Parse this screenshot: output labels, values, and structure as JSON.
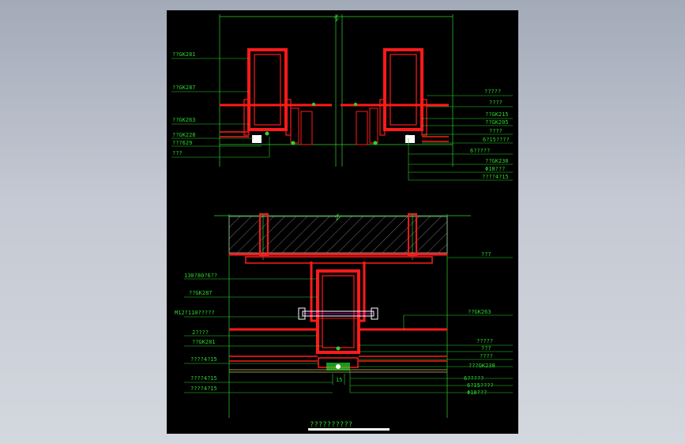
{
  "drawing": {
    "title": "??????????",
    "colors": {
      "background": "#000000",
      "profile": "#ff1a1a",
      "leader": "#2bd62b",
      "frame": "#ffffff",
      "hatch": "#c8c8c8"
    },
    "top_left_labels": [
      "??GK281",
      "??GK287",
      "??GK263",
      "??GK228",
      "???629",
      "???"
    ],
    "top_right_labels": [
      "?????",
      "????",
      "??GK215",
      "??GK205",
      "????",
      "6?15????",
      "6?????",
      "??GK238",
      "Φ18???",
      "????4?15"
    ],
    "bottom_left_labels": [
      "130?80?6??",
      "??GK287",
      "M12?110?????",
      "2????",
      "??GK281",
      "????4?15",
      "????4?15",
      "????4?15"
    ],
    "bottom_right_labels": [
      "???",
      "??GK263",
      "?????",
      "???",
      "????",
      "???GK238",
      "6?????",
      "6?15????",
      "Φ18???"
    ],
    "dimension": "15"
  }
}
